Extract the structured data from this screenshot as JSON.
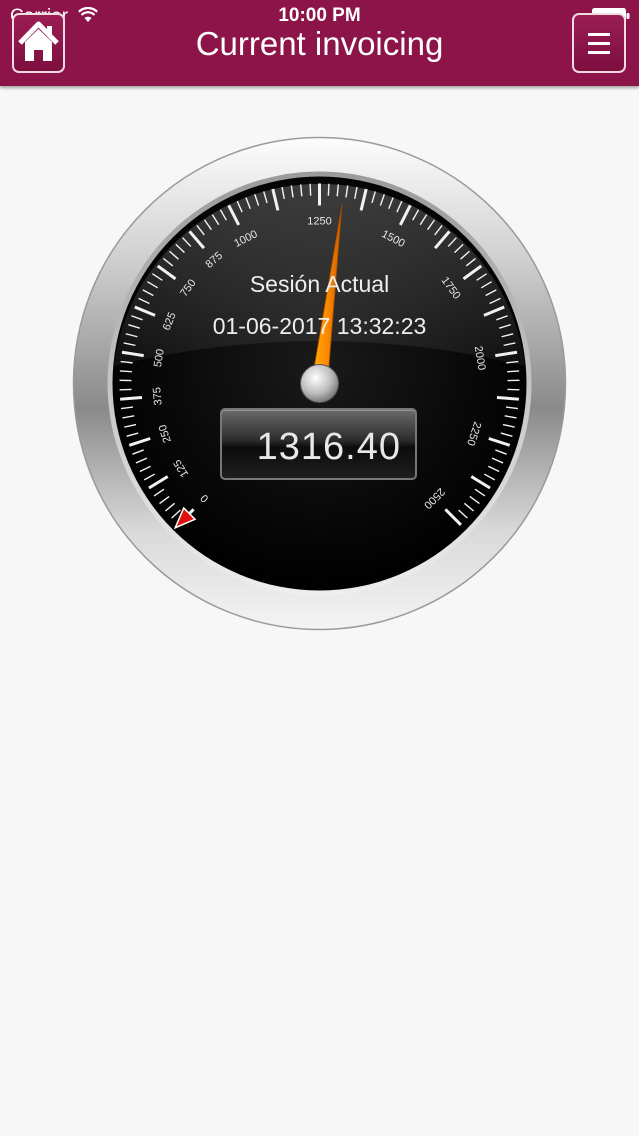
{
  "status_bar": {
    "carrier": "Carrier",
    "time": "10:00 PM"
  },
  "navbar": {
    "title": "Current invoicing",
    "background": "#8c1448",
    "home_icon": "home-icon",
    "menu_icon": "menu-icon"
  },
  "gauge": {
    "session_label": "Sesión Actual",
    "session_datetime": "01-06-2017 13:32:23",
    "odometer_value": "1316.40",
    "needle_value": 1316.4,
    "min": 0,
    "max": 2500,
    "tick_labels": [
      "0",
      "125",
      "250",
      "375",
      "500",
      "625",
      "750",
      "875",
      "1000",
      "1250",
      "1500",
      "1750",
      "2000",
      "2250",
      "2500"
    ],
    "needle_color": "#f08a00",
    "marker_color": "#e01010"
  }
}
